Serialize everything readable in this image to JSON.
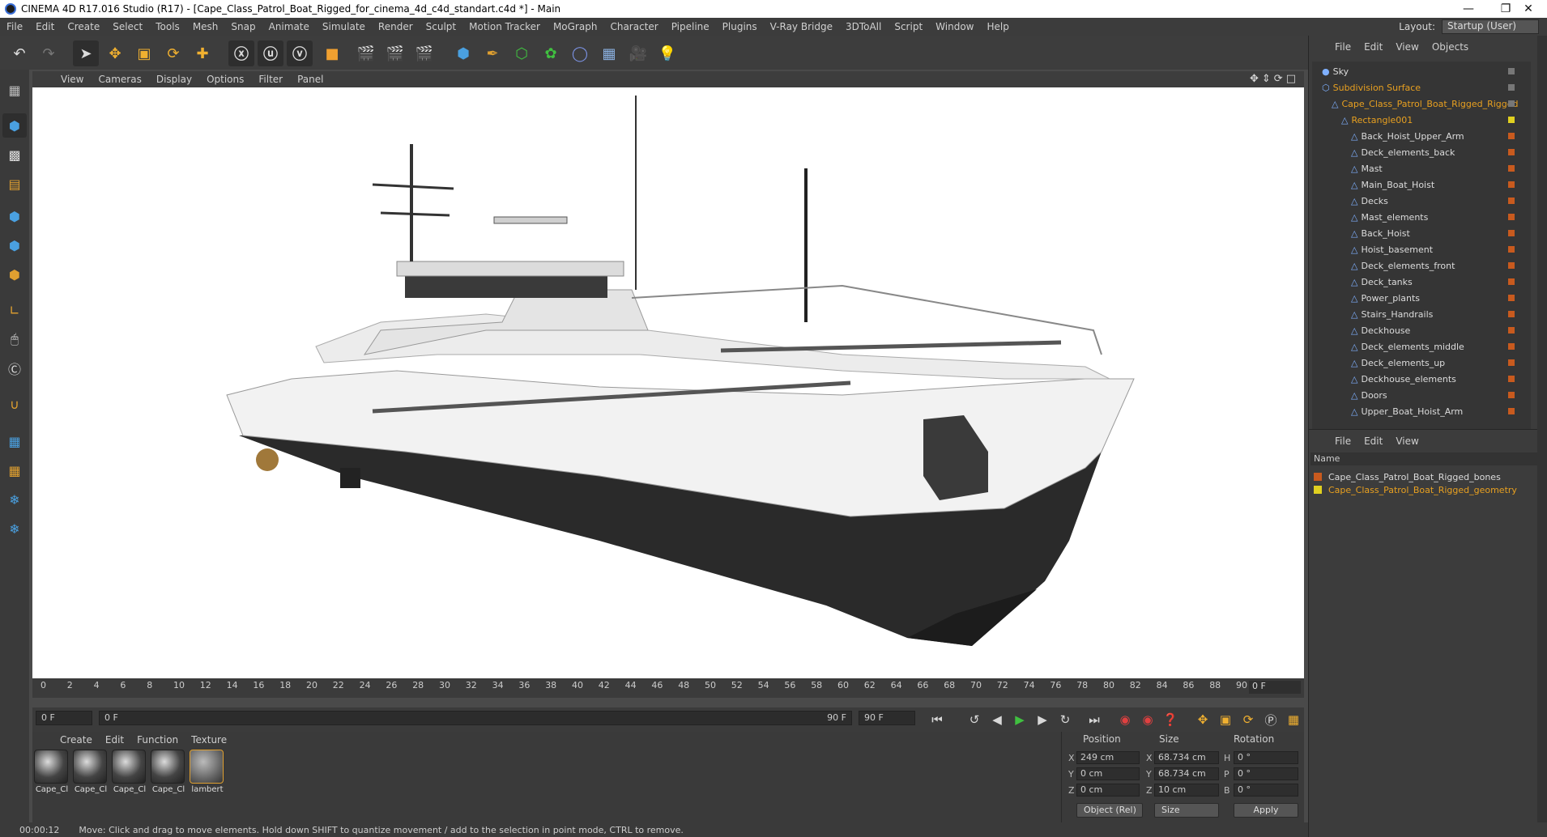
{
  "title": {
    "text": "CINEMA 4D R17.016 Studio (R17) - [Cape_Class_Patrol_Boat_Rigged_for_cinema_4d_c4d_standart.c4d *] - Main"
  },
  "menu": [
    "File",
    "Edit",
    "Create",
    "Select",
    "Tools",
    "Mesh",
    "Snap",
    "Animate",
    "Simulate",
    "Render",
    "Sculpt",
    "Motion Tracker",
    "MoGraph",
    "Character",
    "Pipeline",
    "Plugins",
    "V-Ray Bridge",
    "3DToAll",
    "Script",
    "Window",
    "Help"
  ],
  "layout": {
    "label": "Layout:",
    "value": "Startup (User)"
  },
  "viewport": {
    "menu": [
      "View",
      "Cameras",
      "Display",
      "Options",
      "Filter",
      "Panel"
    ]
  },
  "timeline": {
    "ticks": [
      "0",
      "2",
      "4",
      "6",
      "8",
      "10",
      "12",
      "14",
      "16",
      "18",
      "20",
      "22",
      "24",
      "26",
      "28",
      "30",
      "32",
      "34",
      "36",
      "38",
      "40",
      "42",
      "44",
      "46",
      "48",
      "50",
      "52",
      "54",
      "56",
      "58",
      "60",
      "62",
      "64",
      "66",
      "68",
      "70",
      "72",
      "74",
      "76",
      "78",
      "80",
      "82",
      "84",
      "86",
      "88",
      "90"
    ],
    "end_frame": "0 F",
    "current": "0 F",
    "range_start": "0 F",
    "range_end": "90 F",
    "range_end2": "90 F"
  },
  "materials": {
    "menu": [
      "Create",
      "Edit",
      "Function",
      "Texture"
    ],
    "items": [
      "Cape_Cl",
      "Cape_Cl",
      "Cape_Cl",
      "Cape_Cl",
      "lambert"
    ]
  },
  "coords": {
    "headers": [
      "Position",
      "Size",
      "Rotation"
    ],
    "rows": [
      {
        "axis": "X",
        "pos": "249 cm",
        "saxis": "X",
        "size": "68.734 cm",
        "raxis": "H",
        "rot": "0 °"
      },
      {
        "axis": "Y",
        "pos": "0 cm",
        "saxis": "Y",
        "size": "68.734 cm",
        "raxis": "P",
        "rot": "0 °"
      },
      {
        "axis": "Z",
        "pos": "0 cm",
        "saxis": "Z",
        "size": "10 cm",
        "raxis": "B",
        "rot": "0 °"
      }
    ],
    "mode": "Object (Rel)",
    "size_mode": "Size",
    "apply": "Apply"
  },
  "status": {
    "time": "00:00:12",
    "text": "Move: Click and drag to move elements. Hold down SHIFT to quantize movement / add to the selection in point mode, CTRL to remove."
  },
  "objects": {
    "menu": [
      "File",
      "Edit",
      "View",
      "Objects"
    ],
    "items": [
      {
        "name": "Sky",
        "color": "white",
        "indent": 0
      },
      {
        "name": "Subdivision Surface",
        "color": "orange",
        "indent": 0
      },
      {
        "name": "Cape_Class_Patrol_Boat_Rigged_Rigged",
        "color": "orange",
        "indent": 1
      },
      {
        "name": "Rectangle001",
        "color": "orange",
        "indent": 2
      },
      {
        "name": "Back_Hoist_Upper_Arm",
        "color": "white",
        "indent": 3
      },
      {
        "name": "Deck_elements_back",
        "color": "white",
        "indent": 3
      },
      {
        "name": "Mast",
        "color": "white",
        "indent": 3
      },
      {
        "name": "Main_Boat_Hoist",
        "color": "white",
        "indent": 3
      },
      {
        "name": "Decks",
        "color": "white",
        "indent": 3
      },
      {
        "name": "Mast_elements",
        "color": "white",
        "indent": 3
      },
      {
        "name": "Back_Hoist",
        "color": "white",
        "indent": 3
      },
      {
        "name": "Hoist_basement",
        "color": "white",
        "indent": 3
      },
      {
        "name": "Deck_elements_front",
        "color": "white",
        "indent": 3
      },
      {
        "name": "Deck_tanks",
        "color": "white",
        "indent": 3
      },
      {
        "name": "Power_plants",
        "color": "white",
        "indent": 3
      },
      {
        "name": "Stairs_Handrails",
        "color": "white",
        "indent": 3
      },
      {
        "name": "Deckhouse",
        "color": "white",
        "indent": 3
      },
      {
        "name": "Deck_elements_middle",
        "color": "white",
        "indent": 3
      },
      {
        "name": "Deck_elements_up",
        "color": "white",
        "indent": 3
      },
      {
        "name": "Deckhouse_elements",
        "color": "white",
        "indent": 3
      },
      {
        "name": "Doors",
        "color": "white",
        "indent": 3
      },
      {
        "name": "Upper_Boat_Hoist_Arm",
        "color": "white",
        "indent": 3
      }
    ]
  },
  "layers": {
    "menu": [
      "File",
      "Edit",
      "View"
    ],
    "header": "Name",
    "items": [
      {
        "name": "Cape_Class_Patrol_Boat_Rigged_bones",
        "swatch": "#c85a1e",
        "color": "#dcdcdc"
      },
      {
        "name": "Cape_Class_Patrol_Boat_Rigged_geometry",
        "swatch": "#e0d020",
        "color": "#e8a020"
      }
    ]
  }
}
